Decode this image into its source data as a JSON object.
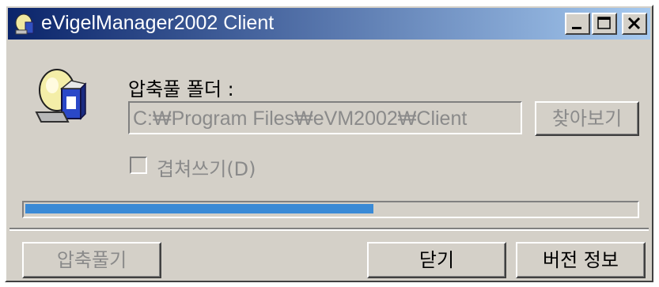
{
  "window": {
    "title": "eVigelManager2002 Client"
  },
  "titlebar_buttons": {
    "minimize": "minimize-icon",
    "maximize": "maximize-icon",
    "close": "close-icon"
  },
  "main": {
    "folder_label": "압축풀 폴더 :",
    "path_value": "C:₩Program Files₩eVM2002₩Client",
    "browse_label": "찾아보기",
    "overwrite_label": "겹쳐쓰기(D)",
    "overwrite_checked": false
  },
  "progress": {
    "percent": 57
  },
  "footer": {
    "extract_label": "압축풀기",
    "close_label": "닫기",
    "version_label": "버전 정보"
  },
  "colors": {
    "title_start": "#0a246a",
    "title_end": "#a6caf0",
    "progress": "#3a8ad6",
    "face": "#d4d0c8"
  }
}
